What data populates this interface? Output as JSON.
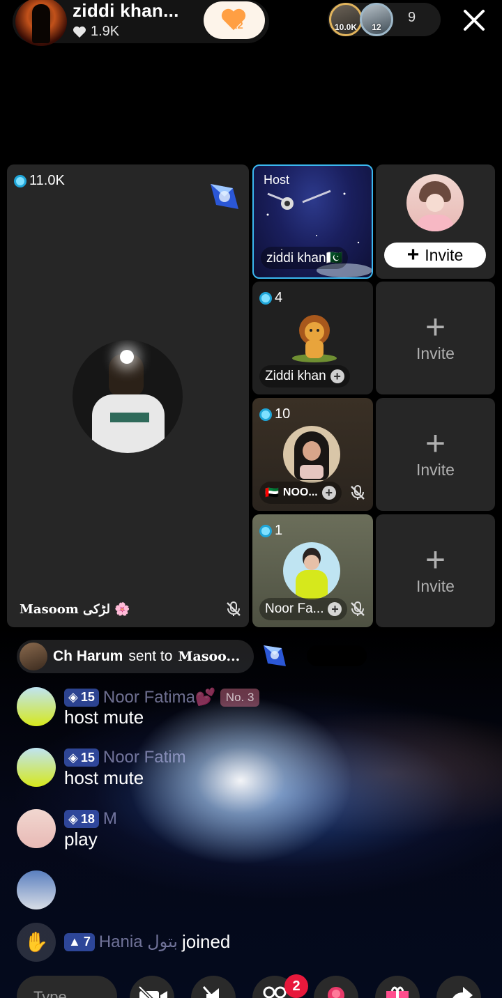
{
  "header": {
    "host_name": "ziddi khan...",
    "host_likes": "1.9K",
    "follow_count": "12",
    "viewer_a_label": "10.0K",
    "viewer_b_label": "12",
    "viewer_count": "9"
  },
  "main_tile": {
    "score": "11.0K",
    "name_label": "Masoom لڑکی 🌸"
  },
  "seats": {
    "host_label": "Host",
    "host_name": "ziddi khan🇵🇰",
    "invite_label": "Invite",
    "lion_score": "4",
    "lion_name": "Ziddi khan",
    "noor1_score": "10",
    "noor1_name": "NOO...",
    "noor1_flag": "🇦🇪",
    "noor2_score": "1",
    "noor2_name": "Noor Fa..."
  },
  "invite_slots": [
    "Invite",
    "Invite",
    "Invite"
  ],
  "chat": {
    "gift_sender": "Ch Harum",
    "gift_verb": "sent to",
    "gift_target": "Masoo...",
    "messages": [
      {
        "level": "15",
        "name": "Noor Fatima💕",
        "badge": "No. 3",
        "text": "host mute"
      },
      {
        "level": "15",
        "name": "Noor Fatim",
        "badge": "",
        "text": "host mute"
      },
      {
        "level": "18",
        "name": "M",
        "badge": "",
        "text": "play"
      }
    ],
    "join": {
      "level": "7",
      "name": "Hania بتول",
      "text": "joined"
    }
  },
  "bottom": {
    "input_placeholder": "Type...",
    "notif_count": "2"
  },
  "colors": {
    "accent_blue": "#3bb8f0",
    "tile_bg": "#262626",
    "notif_red": "#e8193c",
    "follow_orange": "#ff9f43"
  },
  "icons": [
    "heart-icon",
    "close-icon",
    "mic-off-icon",
    "plus-icon",
    "camera-off-icon",
    "speaker-off-icon",
    "people-icon",
    "rose-gift-icon",
    "gift-box-icon",
    "share-icon",
    "wave-hand-icon"
  ]
}
